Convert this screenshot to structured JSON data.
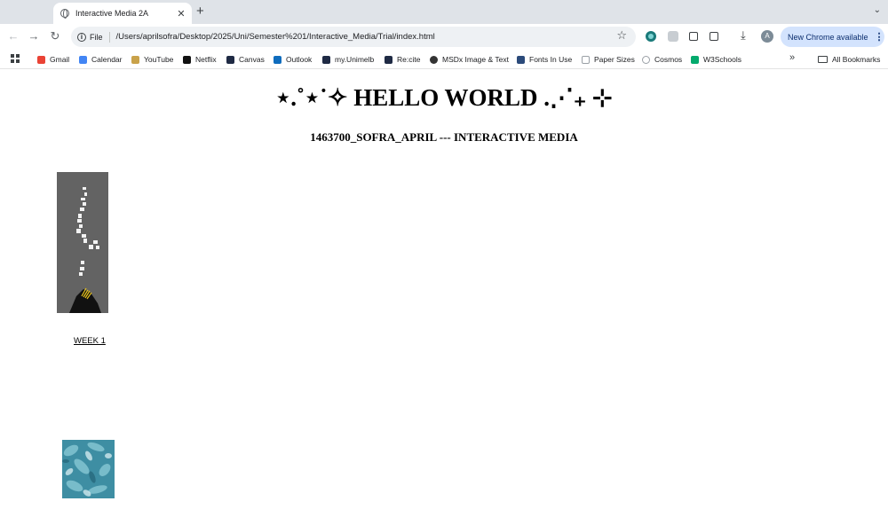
{
  "browser": {
    "tab": {
      "title": "Interactive Media 2A"
    },
    "address": {
      "chip": "File",
      "url": "/Users/aprilsofra/Desktop/2025/Uni/Semester%201/Interactive_Media/Trial/index.html"
    },
    "update_button": "New Chrome available",
    "avatar_letter": "A"
  },
  "bookmarks": {
    "items": [
      {
        "label": "Gmail",
        "color": "#ea4335"
      },
      {
        "label": "Calendar",
        "color": "#4285f4"
      },
      {
        "label": "YouTube",
        "color": "#c9a24a"
      },
      {
        "label": "Netflix",
        "color": "#111111"
      },
      {
        "label": "Canvas",
        "color": "#1f2a44"
      },
      {
        "label": "Outlook",
        "color": "#0f6cbd"
      },
      {
        "label": "my.Unimelb",
        "color": "#1f2a44"
      },
      {
        "label": "Re:cite",
        "color": "#1f2a44"
      },
      {
        "label": "MSDx Image & Text",
        "color": "#333333"
      },
      {
        "label": "Fonts In Use",
        "color": "#2b4a7a"
      },
      {
        "label": "Paper Sizes",
        "color": "#9aa0a6"
      },
      {
        "label": "Cosmos",
        "color": "#9aa0a6"
      },
      {
        "label": "W3Schools",
        "color": "#04aa6d"
      }
    ],
    "all_bookmarks": "All Bookmarks"
  },
  "page": {
    "heading": "⋆.˚⋆˙✧ HELLO WORLD .⋰₊ ⊹",
    "subheading": "1463700_SOFRA_APRIL --- INTERACTIVE MEDIA",
    "week_link": "WEEK 1"
  }
}
